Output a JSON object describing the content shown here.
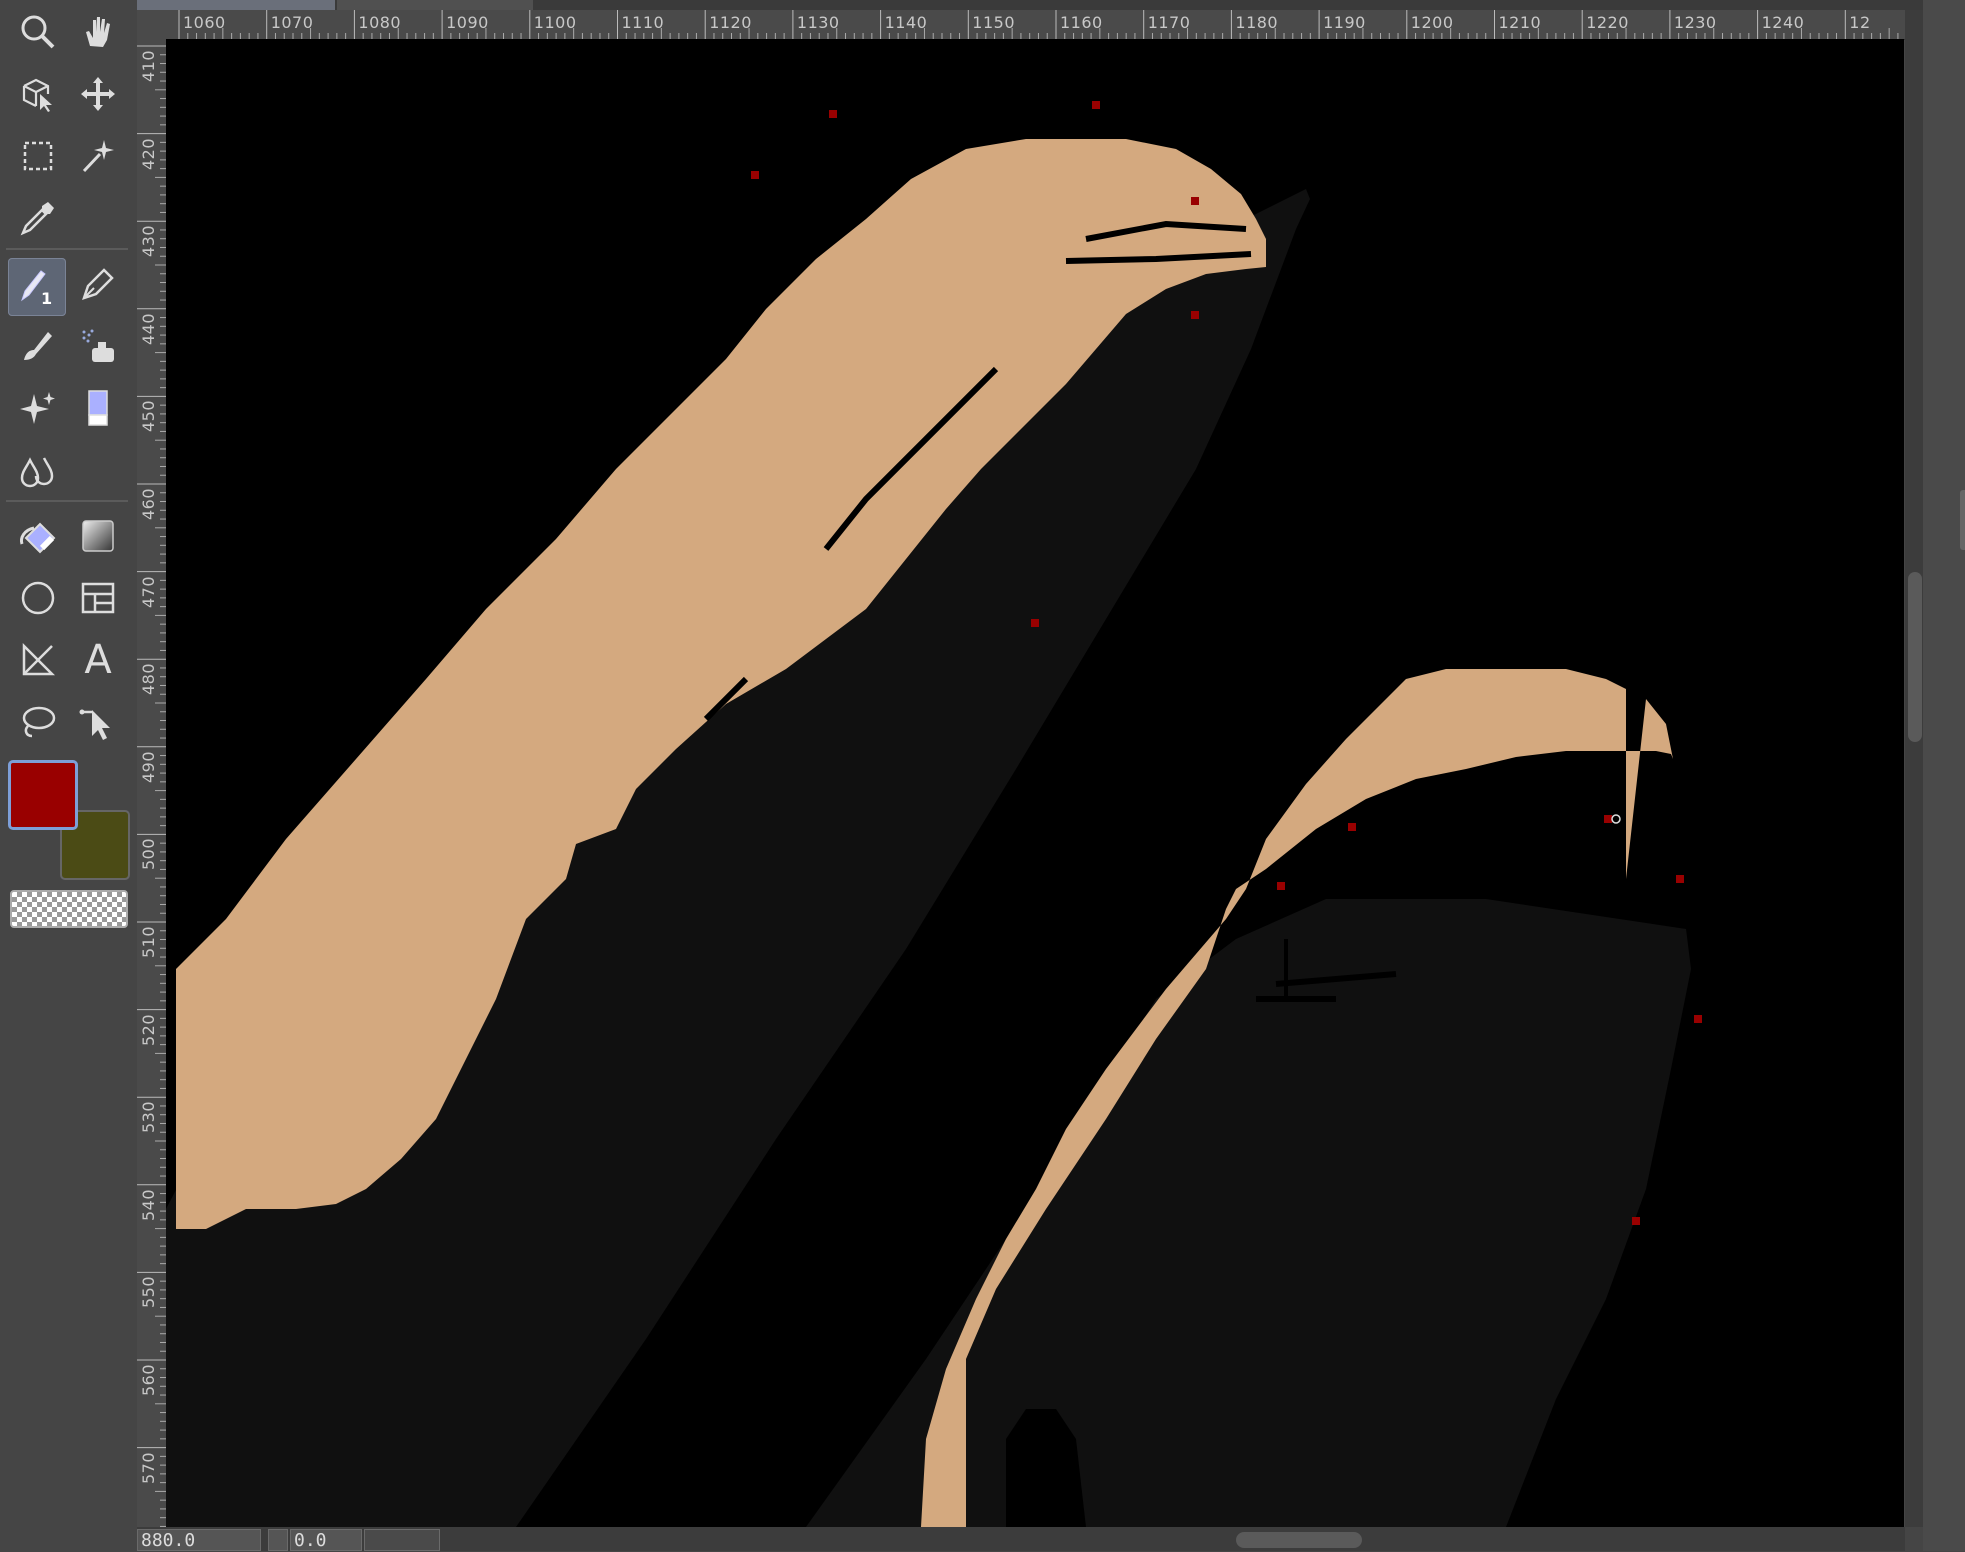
{
  "toolbox": {
    "tools": [
      {
        "id": "zoom",
        "icon": "magnifier-icon"
      },
      {
        "id": "pan",
        "icon": "hand-icon"
      },
      {
        "id": "transform",
        "icon": "cube-cursor-icon"
      },
      {
        "id": "move",
        "icon": "move-arrows-icon"
      },
      {
        "id": "rect-select",
        "icon": "dashed-rectangle-icon"
      },
      {
        "id": "fuzzy-select",
        "icon": "magic-wand-icon"
      },
      {
        "id": "color-picker",
        "icon": "eyedropper-icon"
      },
      {
        "id": "pencil",
        "icon": "pencil-icon",
        "active": true,
        "badge": "1"
      },
      {
        "id": "ink-pen",
        "icon": "pen-nib-icon"
      },
      {
        "id": "paintbrush",
        "icon": "paintbrush-icon"
      },
      {
        "id": "airbrush",
        "icon": "airbrush-icon"
      },
      {
        "id": "heal",
        "icon": "sparkle-icon"
      },
      {
        "id": "eraser",
        "icon": "eraser-icon"
      },
      {
        "id": "smudge",
        "icon": "drops-icon"
      },
      {
        "id": "bucket-fill",
        "icon": "bucket-icon"
      },
      {
        "id": "gradient",
        "icon": "gradient-icon"
      },
      {
        "id": "ellipse",
        "icon": "circle-icon"
      },
      {
        "id": "layout",
        "icon": "layout-icon"
      },
      {
        "id": "perspective",
        "icon": "triangle-ruler-icon"
      },
      {
        "id": "text",
        "icon": "text-icon",
        "label": "A"
      },
      {
        "id": "lasso",
        "icon": "lasso-icon"
      },
      {
        "id": "path",
        "icon": "path-cursor-icon"
      }
    ],
    "foreground_color": "#990000",
    "background_color": "#4b4b15"
  },
  "ruler": {
    "horizontal_labels": [
      "1060",
      "1070",
      "1080",
      "1090",
      "1100",
      "1110",
      "1120",
      "1130",
      "1140",
      "1150",
      "1160",
      "1170",
      "1180",
      "1190",
      "1200",
      "1210",
      "1220",
      "1230",
      "1240",
      "12"
    ],
    "vertical_labels": [
      "410",
      "420",
      "430",
      "440",
      "450",
      "460",
      "470",
      "480",
      "490",
      "500",
      "510",
      "520",
      "530",
      "540",
      "550",
      "560",
      "570"
    ]
  },
  "canvas": {
    "background": "#000000",
    "skin_color": "#d4a97f",
    "shadow_color": "#101010",
    "marker_color": "#990000"
  },
  "statusbar": {
    "coord_x": "880.0",
    "coord_y": "0.0"
  }
}
